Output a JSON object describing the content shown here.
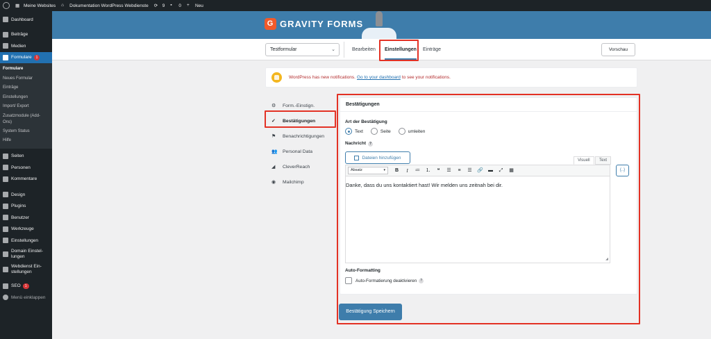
{
  "adminbar": {
    "site_name": "Meine Websites",
    "doc_name": "Dokumentation WordPress Webdienste",
    "updates_count": "9",
    "comments_count": "0",
    "new_label": "Neu"
  },
  "sidebar": {
    "items": [
      {
        "label": "Dashboard"
      },
      {
        "label": "Beiträge"
      },
      {
        "label": "Medien"
      },
      {
        "label": "Formulare",
        "badge": "1"
      },
      {
        "label": "Seiten"
      },
      {
        "label": "Personen"
      },
      {
        "label": "Kommentare"
      },
      {
        "label": "Design"
      },
      {
        "label": "Plugins"
      },
      {
        "label": "Benutzer"
      },
      {
        "label": "Werkzeuge"
      },
      {
        "label": "Einstellungen"
      },
      {
        "label": "Domain Einstel-\nlungen"
      },
      {
        "label": "Webdienst Ein-\nstellungen"
      },
      {
        "label": "SEO",
        "badge": "1"
      },
      {
        "label": "Menü einklappen"
      }
    ],
    "submenu": [
      "Formulare",
      "Neues Formular",
      "Einträge",
      "Einstellungen",
      "Import/ Export",
      "Zusatzmodule (Add-Ons)",
      "System Status",
      "Hilfe"
    ]
  },
  "gf": {
    "logo_text": "GRAVITY FORMS",
    "logo_letter": "G",
    "form_select": "Testformular",
    "tabs": [
      "Bearbeiten",
      "Einstellungen",
      "Einträge"
    ],
    "preview": "Vorschau"
  },
  "notice": {
    "text_before": "WordPress has new notifications.",
    "link": "Go to your dashboard",
    "text_after": "to see your notifications."
  },
  "settings_nav": [
    "Form.-Einstign.",
    "Bestätigungen",
    "Benachrichtigungen",
    "Personal Data",
    "CleverReach",
    "Mailchimp"
  ],
  "card": {
    "title": "Bestätigungen",
    "type_label": "Art der Bestätigung",
    "radio_options": [
      "Text",
      "Seite",
      "umleiten"
    ],
    "message_label": "Nachricht",
    "media_button": "Dateien hinzufügen",
    "editor_tabs": [
      "Visuell",
      "Text"
    ],
    "format_select": "Absatz",
    "merge_tag": "{..}",
    "editor_content": "Danke, dass du uns kontaktiert hast! Wir melden uns zeitnah bei dir.",
    "autoformat_label": "Auto-Formatting",
    "autoformat_checkbox": "Auto-Formatierung deaktivieren",
    "help": "?"
  },
  "save_button": "Bestätigung Speichern",
  "colors": {
    "accent": "#3e7dab",
    "highlight": "#e33124",
    "admin_bg": "#1d2327",
    "active_menu": "#2271b1"
  }
}
